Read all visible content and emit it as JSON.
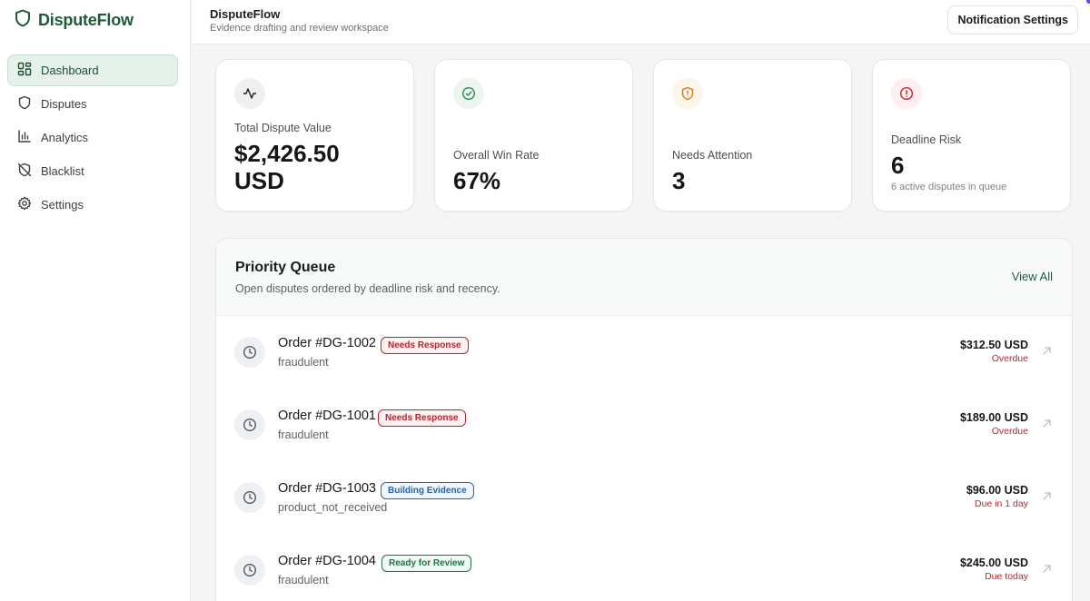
{
  "app": {
    "brand": "DisputeFlow"
  },
  "sidebar": {
    "items": [
      {
        "label": "Dashboard",
        "icon": "dashboard-icon",
        "active": true
      },
      {
        "label": "Disputes",
        "icon": "shield-icon"
      },
      {
        "label": "Analytics",
        "icon": "bar-chart-icon"
      },
      {
        "label": "Blacklist",
        "icon": "shield-off-icon"
      },
      {
        "label": "Settings",
        "icon": "gear-icon"
      }
    ]
  },
  "header": {
    "title": "DisputeFlow",
    "subtitle": "Evidence drafting and review workspace",
    "notification_button": "Notification Settings"
  },
  "stats": [
    {
      "label": "Total Dispute Value",
      "value_line1": "$2,426.50",
      "value_line2": "USD",
      "icon": "activity-icon",
      "color": "#1f5a37"
    },
    {
      "label": "Overall Win Rate",
      "value": "67%",
      "icon": "check-circle-icon",
      "color": "#2a8a55"
    },
    {
      "label": "Needs Attention",
      "value": "3",
      "icon": "shield-alert-icon",
      "color": "#d97a16"
    },
    {
      "label": "Deadline Risk",
      "value": "6",
      "note": "6 active disputes in queue",
      "icon": "alert-circle-icon",
      "color": "#c0262d"
    }
  ],
  "queue": {
    "title": "Priority Queue",
    "subtitle": "Open disputes ordered by deadline risk and recency.",
    "view_all": "View All",
    "rows": [
      {
        "order": "Order #DG-1002",
        "status": "Needs Response",
        "reason": "fraudulent",
        "amount": "$312.50 USD",
        "due": "Overdue"
      },
      {
        "order": "Order #DG-1001",
        "status": "Needs Response",
        "reason": "fraudulent",
        "amount": "$189.00 USD",
        "due": "Overdue"
      },
      {
        "order": "Order #DG-1003",
        "status": "Building Evidence",
        "reason": "product_not_received",
        "amount": "$96.00 USD",
        "due": "Due in 1 day"
      },
      {
        "order": "Order #DG-1004",
        "status": "Ready for Review",
        "reason": "fraudulent",
        "amount": "$245.00 USD",
        "due": "Due today"
      }
    ]
  },
  "colors": {
    "brand": "#1f5a37",
    "danger": "#c0262d",
    "info": "#2a64a3",
    "success": "#237245",
    "warning": "#d97a16"
  }
}
